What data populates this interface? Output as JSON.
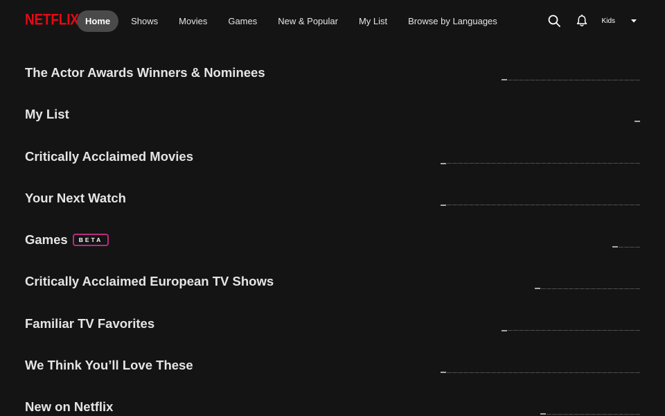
{
  "brand": {
    "logo_text": "NETFLIX",
    "logo_color": "#e50914"
  },
  "nav": {
    "items": [
      {
        "label": "Home",
        "active": true
      },
      {
        "label": "Shows",
        "active": false
      },
      {
        "label": "Movies",
        "active": false
      },
      {
        "label": "Games",
        "active": false
      },
      {
        "label": "New & Popular",
        "active": false
      },
      {
        "label": "My List",
        "active": false
      },
      {
        "label": "Browse by Languages",
        "active": false
      }
    ]
  },
  "header_controls": {
    "search_icon": "search-icon",
    "notifications_icon": "bell-icon",
    "profile_label": "Kids",
    "menu_icon": "caret-down-icon"
  },
  "rows": [
    {
      "title": "The Actor Awards Winners & Nominees",
      "badge": "",
      "pages": 25,
      "current_page": 1
    },
    {
      "title": "My List",
      "badge": "",
      "pages": 1,
      "current_page": 1
    },
    {
      "title": "Critically Acclaimed Movies",
      "badge": "",
      "pages": 36,
      "current_page": 1
    },
    {
      "title": "Your Next Watch",
      "badge": "",
      "pages": 36,
      "current_page": 1
    },
    {
      "title": "Games",
      "badge": "BETA",
      "pages": 5,
      "current_page": 1
    },
    {
      "title": "Critically Acclaimed European TV Shows",
      "badge": "",
      "pages": 19,
      "current_page": 1
    },
    {
      "title": "Familiar TV Favorites",
      "badge": "",
      "pages": 25,
      "current_page": 1
    },
    {
      "title": "We Think You’ll Love These",
      "badge": "",
      "pages": 36,
      "current_page": 1
    },
    {
      "title": "New on Netflix",
      "badge": "",
      "pages": 18,
      "current_page": 1
    }
  ],
  "colors": {
    "background": "#141414",
    "active_nav_pill": "#4a4a4a",
    "beta_border": "#b82c7f",
    "pager_active": "#aaaaaa",
    "pager_inactive": "#4d4d4d"
  }
}
